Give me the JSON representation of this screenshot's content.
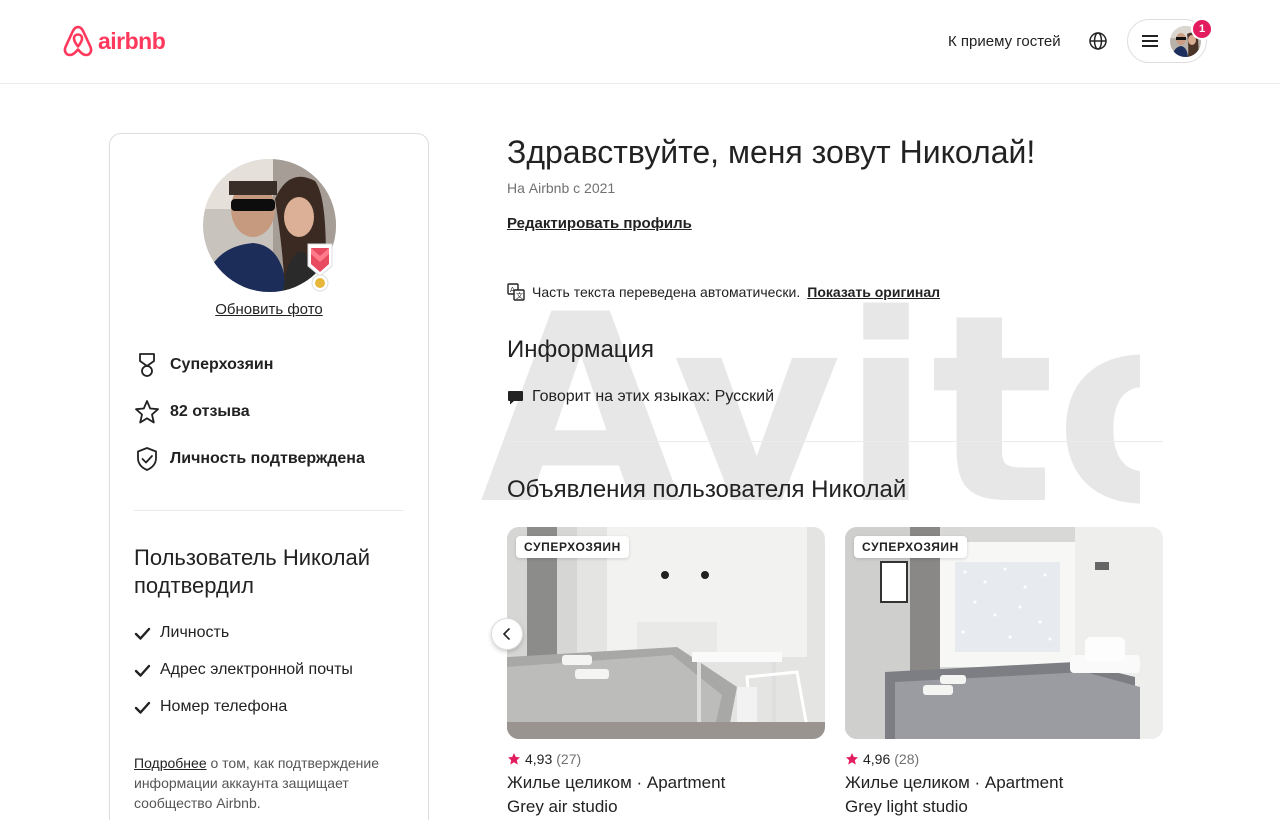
{
  "header": {
    "logo_text": "airbnb",
    "host_link": "К приему гостей",
    "notification_count": "1",
    "brand_color": "#ff385c"
  },
  "profile_card": {
    "update_photo": "Обновить фото",
    "stats": [
      {
        "icon": "superhost-medal-icon",
        "label": "Суперхозяин"
      },
      {
        "icon": "star-icon",
        "label": "82 отзыва"
      },
      {
        "icon": "shield-check-icon",
        "label": "Личность подтверждена"
      }
    ],
    "verified_title": "Пользователь Николай подтвердил",
    "verified_items": [
      "Личность",
      "Адрес электронной почты",
      "Номер телефона"
    ],
    "learn_more_link": "Подробнее",
    "learn_more_text": " о том, как подтверждение информации аккаунта защищает сообщество Airbnb."
  },
  "main": {
    "greeting": "Здравствуйте, меня зовут Николай!",
    "since": "На Airbnb с 2021",
    "edit_profile": "Редактировать профиль",
    "translated_text": "Часть текста переведена автоматически.",
    "show_original": "Показать оригинал",
    "info_title": "Информация",
    "languages": "Говорит на этих языках: Русский",
    "listings_title": "Объявления пользователя Николай",
    "listings": [
      {
        "tag": "СУПЕРХОЗЯИН",
        "rating": "4,93",
        "reviews": "(27)",
        "type": "Жилье целиком · Apartment",
        "name": "Grey air studio"
      },
      {
        "tag": "СУПЕРХОЗЯИН",
        "rating": "4,96",
        "reviews": "(28)",
        "type": "Жилье целиком · Apartment",
        "name": "Grey light studio"
      }
    ]
  },
  "watermark": "Avito"
}
